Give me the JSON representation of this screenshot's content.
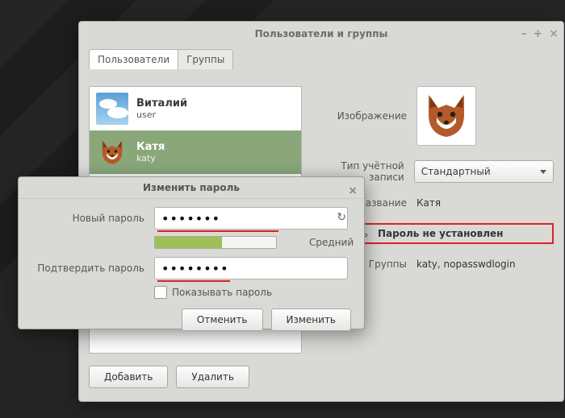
{
  "mainwin": {
    "title": "Пользователи и группы",
    "tabs": [
      {
        "label": "Пользователи",
        "active": true
      },
      {
        "label": "Группы",
        "active": false
      }
    ],
    "users": [
      {
        "name": "Виталий",
        "login": "user",
        "avatar": "sky",
        "selected": false
      },
      {
        "name": "Катя",
        "login": "katy",
        "avatar": "fox",
        "selected": true
      }
    ],
    "detail": {
      "image_label": "Изображение",
      "account_type_label": "Тип учётной записи",
      "account_type_value": "Стандартный",
      "name_label": "Название",
      "name_value": "Катя",
      "password_label": "Пароль",
      "password_value": "Пароль не установлен",
      "groups_label": "Группы",
      "groups_value": "katy, nopasswdlogin"
    },
    "buttons": {
      "add": "Добавить",
      "delete": "Удалить"
    }
  },
  "dialog": {
    "title": "Изменить пароль",
    "new_pw_label": "Новый пароль",
    "new_pw_value": "•••••••",
    "confirm_label": "Подтвердить пароль",
    "confirm_value": "••••••••",
    "strength_label": "Средний",
    "strength_pct": 55,
    "show_pw_label": "Показывать пароль",
    "cancel": "Отменить",
    "apply": "Изменить"
  }
}
